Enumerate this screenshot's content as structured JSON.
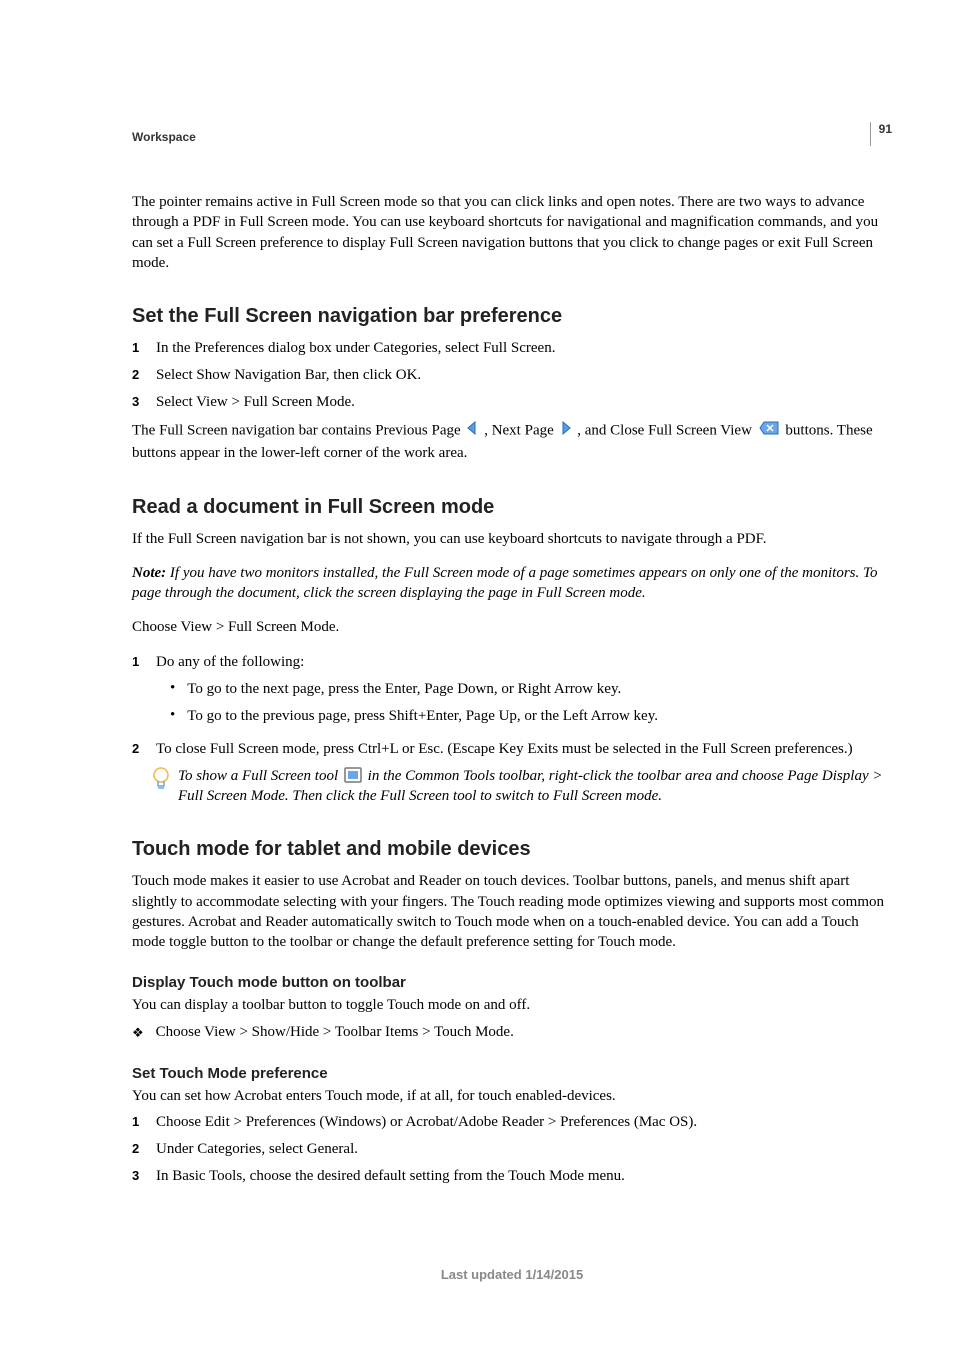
{
  "pageNumber": "91",
  "sectionLabel": "Workspace",
  "intro": "The pointer remains active in Full Screen mode so that you can click links and open notes. There are two ways to advance through a PDF in Full Screen mode. You can use keyboard shortcuts for navigational and magnification commands, and you can set a Full Screen preference to display Full Screen navigation buttons that you click to change pages or exit Full Screen mode.",
  "h1": {
    "title": "Set the Full Screen navigation bar preference",
    "steps": [
      "In the Preferences dialog box under Categories, select Full Screen.",
      "Select Show Navigation Bar, then click OK.",
      "Select View > Full Screen Mode."
    ],
    "after_pre": "The Full Screen navigation bar contains Previous Page ",
    "after_mid1": " , Next Page ",
    "after_mid2": " , and Close Full Screen View ",
    "after_post": " buttons. These buttons appear in the lower-left corner of the work area."
  },
  "h2": {
    "title": "Read a document in Full Screen mode",
    "body1": "If the Full Screen navigation bar is not shown, you can use keyboard shortcuts to navigate through a PDF.",
    "noteLabel": "Note: ",
    "noteBody": "If you have two monitors installed, the Full Screen mode of a page sometimes appears on only one of the monitors. To page through the document, click the screen displaying the page in Full Screen mode.",
    "body2": "Choose View > Full Screen Mode.",
    "step1_lead": "Do any of the following:",
    "step1_bullets": [
      "To go to the next page, press the Enter, Page Down, or Right Arrow key.",
      "To go to the previous page, press Shift+Enter, Page Up, or the Left Arrow key."
    ],
    "step2": "To close Full Screen mode, press Ctrl+L or Esc. (Escape Key Exits must be selected in the Full Screen preferences.)",
    "tip_pre": "To show a Full Screen tool ",
    "tip_post": " in the Common Tools toolbar, right-click the toolbar area and choose Page Display > Full Screen Mode. Then click the Full Screen tool to switch to Full Screen mode."
  },
  "h3": {
    "title": "Touch mode for tablet and mobile devices",
    "body": "Touch mode makes it easier to use Acrobat and Reader on touch devices. Toolbar buttons, panels, and menus shift apart slightly to accommodate selecting with your fingers. The Touch reading mode optimizes viewing and supports most common gestures. Acrobat and Reader automatically switch to Touch mode when on a touch-enabled device. You can add a Touch mode toggle button to the toolbar or change the default preference setting for Touch mode.",
    "sub1_title": "Display Touch mode button on toolbar",
    "sub1_body": "You can display a toolbar button to toggle Touch mode on and off.",
    "sub1_step": "Choose View > Show/Hide > Toolbar Items > Touch Mode.",
    "sub2_title": "Set Touch Mode preference",
    "sub2_body": "You can set how Acrobat enters Touch mode, if at all, for touch enabled-devices.",
    "sub2_steps": [
      "Choose Edit > Preferences (Windows) or Acrobat/Adobe Reader > Preferences (Mac OS).",
      "Under Categories, select General.",
      "In Basic Tools, choose the desired default setting from the Touch Mode menu."
    ]
  },
  "footer": "Last updated 1/14/2015"
}
